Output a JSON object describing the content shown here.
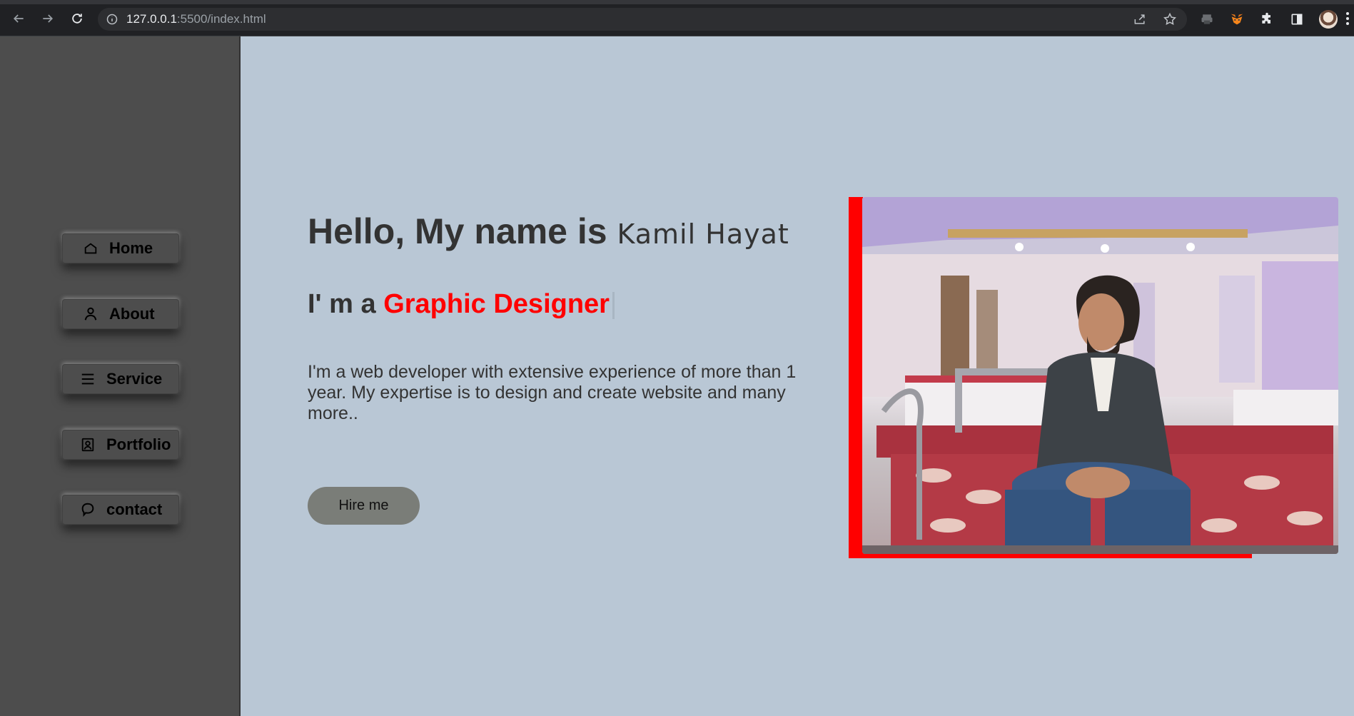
{
  "browser": {
    "url_host": "127.0.0.1",
    "url_path": ":5500/index.html"
  },
  "sidebar": {
    "items": [
      {
        "label": "Home",
        "icon": "home-icon"
      },
      {
        "label": "About",
        "icon": "user-icon"
      },
      {
        "label": "Service",
        "icon": "list-icon"
      },
      {
        "label": "Portfolio",
        "icon": "portrait-icon"
      },
      {
        "label": "contact",
        "icon": "chat-bubble-icon"
      }
    ]
  },
  "hero": {
    "greeting_prefix": "Hello, My name is",
    "name": "Kamil Hayat",
    "role_prefix": "I' m a",
    "role_highlight": "Graphic Designer",
    "bio": "I'm a web developer with extensive experience of more than 1 year. My expertise is to design and create website and many more..",
    "hire_button": "Hire me"
  },
  "colors": {
    "accent": "#ff0000",
    "page_background": "#b9c7d5",
    "sidebar_background": "#4d4d4d",
    "button_background": "#7a7d78"
  }
}
